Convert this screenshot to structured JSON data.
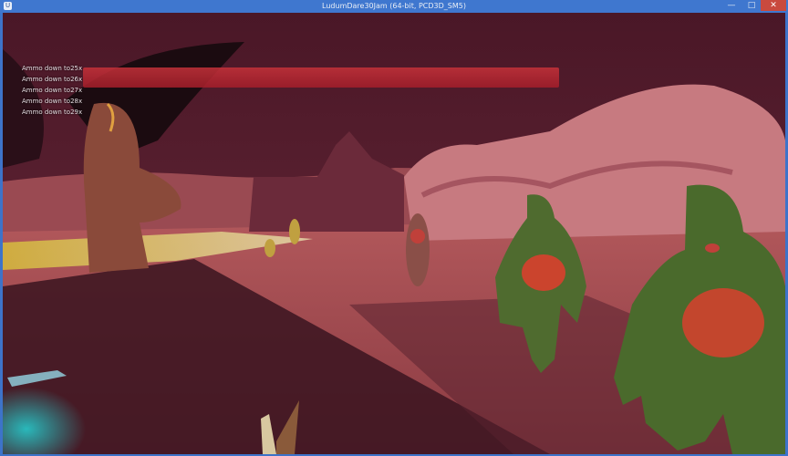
{
  "window": {
    "title": "LudumDare30Jam (64-bit, PCD3D_SM5)",
    "app_icon": "unreal-engine-icon",
    "buttons": {
      "minimize": "—",
      "maximize": "□",
      "close": "✕"
    }
  },
  "hud": {
    "log_lines": [
      "Ammo down to25x",
      "Ammo down to26x",
      "Ammo down to27x",
      "Ammo down to28x",
      "Ammo down to29x"
    ],
    "health_fill": 1.0,
    "health_color": "#c7323a"
  },
  "scene": {
    "sky_color": "#3c1422",
    "ground_color": "#b25a5c",
    "enemy_count": 5,
    "enemy_skin_color": "#4f6b2f",
    "enemy_chest_color": "#d8402e",
    "accent_glow_color": "#22e0e0"
  }
}
